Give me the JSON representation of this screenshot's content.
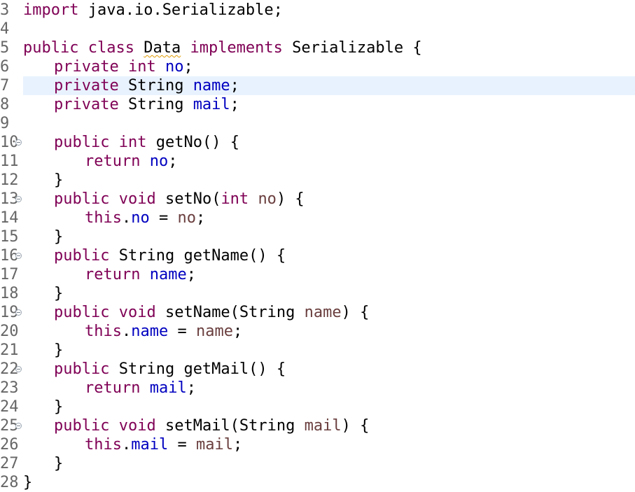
{
  "editor": {
    "current_line": "7",
    "lines": [
      {
        "n": "3",
        "fold": false,
        "indent": 0,
        "tokens": [
          {
            "t": "import",
            "c": "kw"
          },
          {
            "t": " java.io.Serializable;",
            "c": ""
          }
        ]
      },
      {
        "n": "4",
        "fold": false,
        "indent": 0,
        "tokens": []
      },
      {
        "n": "5",
        "fold": false,
        "indent": 0,
        "tokens": [
          {
            "t": "public",
            "c": "kw"
          },
          {
            "t": " ",
            "c": ""
          },
          {
            "t": "class",
            "c": "kw"
          },
          {
            "t": " ",
            "c": ""
          },
          {
            "t": "Data",
            "c": "sq"
          },
          {
            "t": " ",
            "c": ""
          },
          {
            "t": "implements",
            "c": "kw"
          },
          {
            "t": " Serializable {",
            "c": ""
          }
        ]
      },
      {
        "n": "6",
        "fold": false,
        "indent": 1,
        "tokens": [
          {
            "t": "private",
            "c": "kw"
          },
          {
            "t": " ",
            "c": ""
          },
          {
            "t": "int",
            "c": "kw"
          },
          {
            "t": " ",
            "c": ""
          },
          {
            "t": "no",
            "c": "fld"
          },
          {
            "t": ";",
            "c": ""
          }
        ]
      },
      {
        "n": "7",
        "fold": false,
        "indent": 1,
        "tokens": [
          {
            "t": "private",
            "c": "kw"
          },
          {
            "t": " String ",
            "c": ""
          },
          {
            "t": "name",
            "c": "fld"
          },
          {
            "t": ";",
            "c": ""
          }
        ]
      },
      {
        "n": "8",
        "fold": false,
        "indent": 1,
        "tokens": [
          {
            "t": "private",
            "c": "kw"
          },
          {
            "t": " String ",
            "c": ""
          },
          {
            "t": "mail",
            "c": "fld"
          },
          {
            "t": ";",
            "c": ""
          }
        ]
      },
      {
        "n": "9",
        "fold": false,
        "indent": 0,
        "tokens": []
      },
      {
        "n": "10",
        "fold": true,
        "indent": 1,
        "tokens": [
          {
            "t": "public",
            "c": "kw"
          },
          {
            "t": " ",
            "c": ""
          },
          {
            "t": "int",
            "c": "kw"
          },
          {
            "t": " getNo() {",
            "c": ""
          }
        ]
      },
      {
        "n": "11",
        "fold": false,
        "indent": 2,
        "tokens": [
          {
            "t": "return",
            "c": "kw"
          },
          {
            "t": " ",
            "c": ""
          },
          {
            "t": "no",
            "c": "fld"
          },
          {
            "t": ";",
            "c": ""
          }
        ]
      },
      {
        "n": "12",
        "fold": false,
        "indent": 1,
        "tokens": [
          {
            "t": "}",
            "c": ""
          }
        ]
      },
      {
        "n": "13",
        "fold": true,
        "indent": 1,
        "tokens": [
          {
            "t": "public",
            "c": "kw"
          },
          {
            "t": " ",
            "c": ""
          },
          {
            "t": "void",
            "c": "kw"
          },
          {
            "t": " setNo(",
            "c": ""
          },
          {
            "t": "int",
            "c": "kw"
          },
          {
            "t": " ",
            "c": ""
          },
          {
            "t": "no",
            "c": "prm"
          },
          {
            "t": ") {",
            "c": ""
          }
        ]
      },
      {
        "n": "14",
        "fold": false,
        "indent": 2,
        "tokens": [
          {
            "t": "this",
            "c": "kw"
          },
          {
            "t": ".",
            "c": ""
          },
          {
            "t": "no",
            "c": "fld"
          },
          {
            "t": " = ",
            "c": ""
          },
          {
            "t": "no",
            "c": "prm"
          },
          {
            "t": ";",
            "c": ""
          }
        ]
      },
      {
        "n": "15",
        "fold": false,
        "indent": 1,
        "tokens": [
          {
            "t": "}",
            "c": ""
          }
        ]
      },
      {
        "n": "16",
        "fold": true,
        "indent": 1,
        "tokens": [
          {
            "t": "public",
            "c": "kw"
          },
          {
            "t": " String getName() {",
            "c": ""
          }
        ]
      },
      {
        "n": "17",
        "fold": false,
        "indent": 2,
        "tokens": [
          {
            "t": "return",
            "c": "kw"
          },
          {
            "t": " ",
            "c": ""
          },
          {
            "t": "name",
            "c": "fld"
          },
          {
            "t": ";",
            "c": ""
          }
        ]
      },
      {
        "n": "18",
        "fold": false,
        "indent": 1,
        "tokens": [
          {
            "t": "}",
            "c": ""
          }
        ]
      },
      {
        "n": "19",
        "fold": true,
        "indent": 1,
        "tokens": [
          {
            "t": "public",
            "c": "kw"
          },
          {
            "t": " ",
            "c": ""
          },
          {
            "t": "void",
            "c": "kw"
          },
          {
            "t": " setName(String ",
            "c": ""
          },
          {
            "t": "name",
            "c": "prm"
          },
          {
            "t": ") {",
            "c": ""
          }
        ]
      },
      {
        "n": "20",
        "fold": false,
        "indent": 2,
        "tokens": [
          {
            "t": "this",
            "c": "kw"
          },
          {
            "t": ".",
            "c": ""
          },
          {
            "t": "name",
            "c": "fld"
          },
          {
            "t": " = ",
            "c": ""
          },
          {
            "t": "name",
            "c": "prm"
          },
          {
            "t": ";",
            "c": ""
          }
        ]
      },
      {
        "n": "21",
        "fold": false,
        "indent": 1,
        "tokens": [
          {
            "t": "}",
            "c": ""
          }
        ]
      },
      {
        "n": "22",
        "fold": true,
        "indent": 1,
        "tokens": [
          {
            "t": "public",
            "c": "kw"
          },
          {
            "t": " String getMail() {",
            "c": ""
          }
        ]
      },
      {
        "n": "23",
        "fold": false,
        "indent": 2,
        "tokens": [
          {
            "t": "return",
            "c": "kw"
          },
          {
            "t": " ",
            "c": ""
          },
          {
            "t": "mail",
            "c": "fld"
          },
          {
            "t": ";",
            "c": ""
          }
        ]
      },
      {
        "n": "24",
        "fold": false,
        "indent": 1,
        "tokens": [
          {
            "t": "}",
            "c": ""
          }
        ]
      },
      {
        "n": "25",
        "fold": true,
        "indent": 1,
        "tokens": [
          {
            "t": "public",
            "c": "kw"
          },
          {
            "t": " ",
            "c": ""
          },
          {
            "t": "void",
            "c": "kw"
          },
          {
            "t": " setMail(String ",
            "c": ""
          },
          {
            "t": "mail",
            "c": "prm"
          },
          {
            "t": ") {",
            "c": ""
          }
        ]
      },
      {
        "n": "26",
        "fold": false,
        "indent": 2,
        "tokens": [
          {
            "t": "this",
            "c": "kw"
          },
          {
            "t": ".",
            "c": ""
          },
          {
            "t": "mail",
            "c": "fld"
          },
          {
            "t": " = ",
            "c": ""
          },
          {
            "t": "mail",
            "c": "prm"
          },
          {
            "t": ";",
            "c": ""
          }
        ]
      },
      {
        "n": "27",
        "fold": false,
        "indent": 1,
        "tokens": [
          {
            "t": "}",
            "c": ""
          }
        ]
      },
      {
        "n": "28",
        "fold": false,
        "indent": 0,
        "tokens": [
          {
            "t": "}",
            "c": ""
          }
        ]
      }
    ]
  },
  "colors": {
    "keyword": "#7f0055",
    "field": "#0000c0",
    "parameter": "#6a3e3e",
    "current_line_highlight": "#e8f2fe",
    "line_number": "#666666",
    "warning_squiggle": "#e09a00"
  },
  "icons": {
    "fold": "collapse-fold-icon"
  }
}
